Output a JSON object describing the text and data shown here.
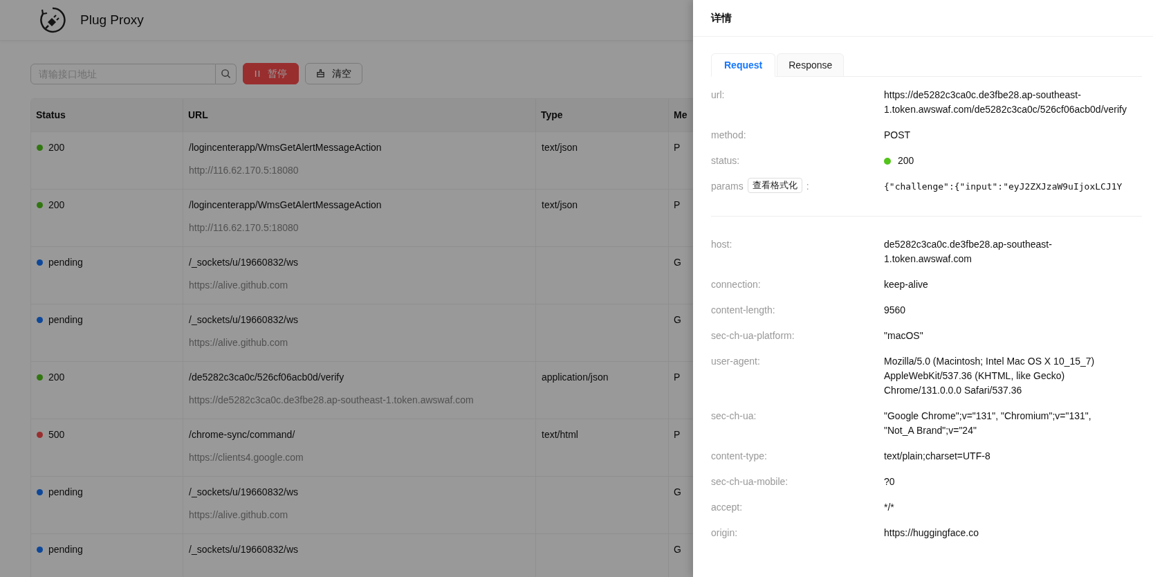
{
  "app": {
    "title": "Plug Proxy"
  },
  "toolbar": {
    "search": {
      "placeholder": "请输接口地址"
    },
    "pause_button": "暂停",
    "clear_button": "清空"
  },
  "table": {
    "columns": [
      "Status",
      "URL",
      "Type",
      "Me"
    ],
    "rows": [
      {
        "status": "200",
        "color": "#317610",
        "path": "/logincenterapp/WmsGetAlertMessageAction",
        "host": "http://116.62.170.5:18080",
        "type": "text/json",
        "method": "P"
      },
      {
        "status": "200",
        "color": "#317610",
        "path": "/logincenterapp/WmsGetAlertMessageAction",
        "host": "http://116.62.170.5:18080",
        "type": "text/json",
        "method": "P"
      },
      {
        "status": "pending",
        "color": "#0d4799",
        "path": "/_sockets/u/19660832/ws",
        "host": "https://alive.github.com",
        "method": "G"
      },
      {
        "status": "pending",
        "color": "#0d4799",
        "path": "/_sockets/u/19660832/ws",
        "host": "https://alive.github.com",
        "method": "G"
      },
      {
        "status": "200",
        "color": "#317610",
        "path": "/de5282c3ca0c/526cf06acb0d/verify",
        "host": "https://de5282c3ca0c.de3fbe28.ap-southeast-1.token.awswaf.com",
        "type": "application/json",
        "method": "P"
      },
      {
        "status": "500",
        "color": "#992e2f",
        "path": "/chrome-sync/command/",
        "host": "https://clients4.google.com",
        "type": "text/html",
        "method": "P"
      },
      {
        "status": "pending",
        "color": "#0d4799",
        "path": "/_sockets/u/19660832/ws",
        "host": "https://alive.github.com",
        "method": "G"
      },
      {
        "status": "pending",
        "color": "#0d4799",
        "path": "/_sockets/u/19660832/ws",
        "method": "G"
      }
    ]
  },
  "drawer": {
    "title": "详情",
    "tabs": [
      {
        "label": "Request",
        "selected": true
      },
      {
        "label": "Response",
        "selected": false
      }
    ],
    "fields": [
      {
        "kind": "text",
        "label": "url:",
        "value": "https://de5282c3ca0c.de3fbe28.ap-southeast-1.token.awswaf.com/de5282c3ca0c/526cf06acb0d/verify"
      },
      {
        "kind": "text",
        "label": "method:",
        "value": "POST"
      },
      {
        "kind": "status",
        "label": "status:",
        "value": "200",
        "color": "#52c41a"
      },
      {
        "kind": "code",
        "label": "params",
        "button": "查看格式化",
        "suffix": ":",
        "value": "{\"challenge\":{\"input\":\"eyJ2ZXJzaW9uIjoxLCJ1Y"
      }
    ],
    "headers": [
      {
        "label": "host:",
        "value": "de5282c3ca0c.de3fbe28.ap-southeast-1.token.awswaf.com"
      },
      {
        "label": "connection:",
        "value": "keep-alive"
      },
      {
        "label": "content-length:",
        "value": "9560"
      },
      {
        "label": "sec-ch-ua-platform:",
        "value": "\"macOS\""
      },
      {
        "label": "user-agent:",
        "value": "Mozilla/5.0 (Macintosh; Intel Mac OS X 10_15_7) AppleWebKit/537.36 (KHTML, like Gecko) Chrome/131.0.0.0 Safari/537.36"
      },
      {
        "label": "sec-ch-ua:",
        "value": "\"Google Chrome\";v=\"131\", \"Chromium\";v=\"131\", \"Not_A Brand\";v=\"24\""
      },
      {
        "label": "content-type:",
        "value": "text/plain;charset=UTF-8"
      },
      {
        "label": "sec-ch-ua-mobile:",
        "value": "?0"
      },
      {
        "label": "accept:",
        "value": "*/*"
      },
      {
        "label": "origin:",
        "value": "https://huggingface.co"
      }
    ]
  }
}
